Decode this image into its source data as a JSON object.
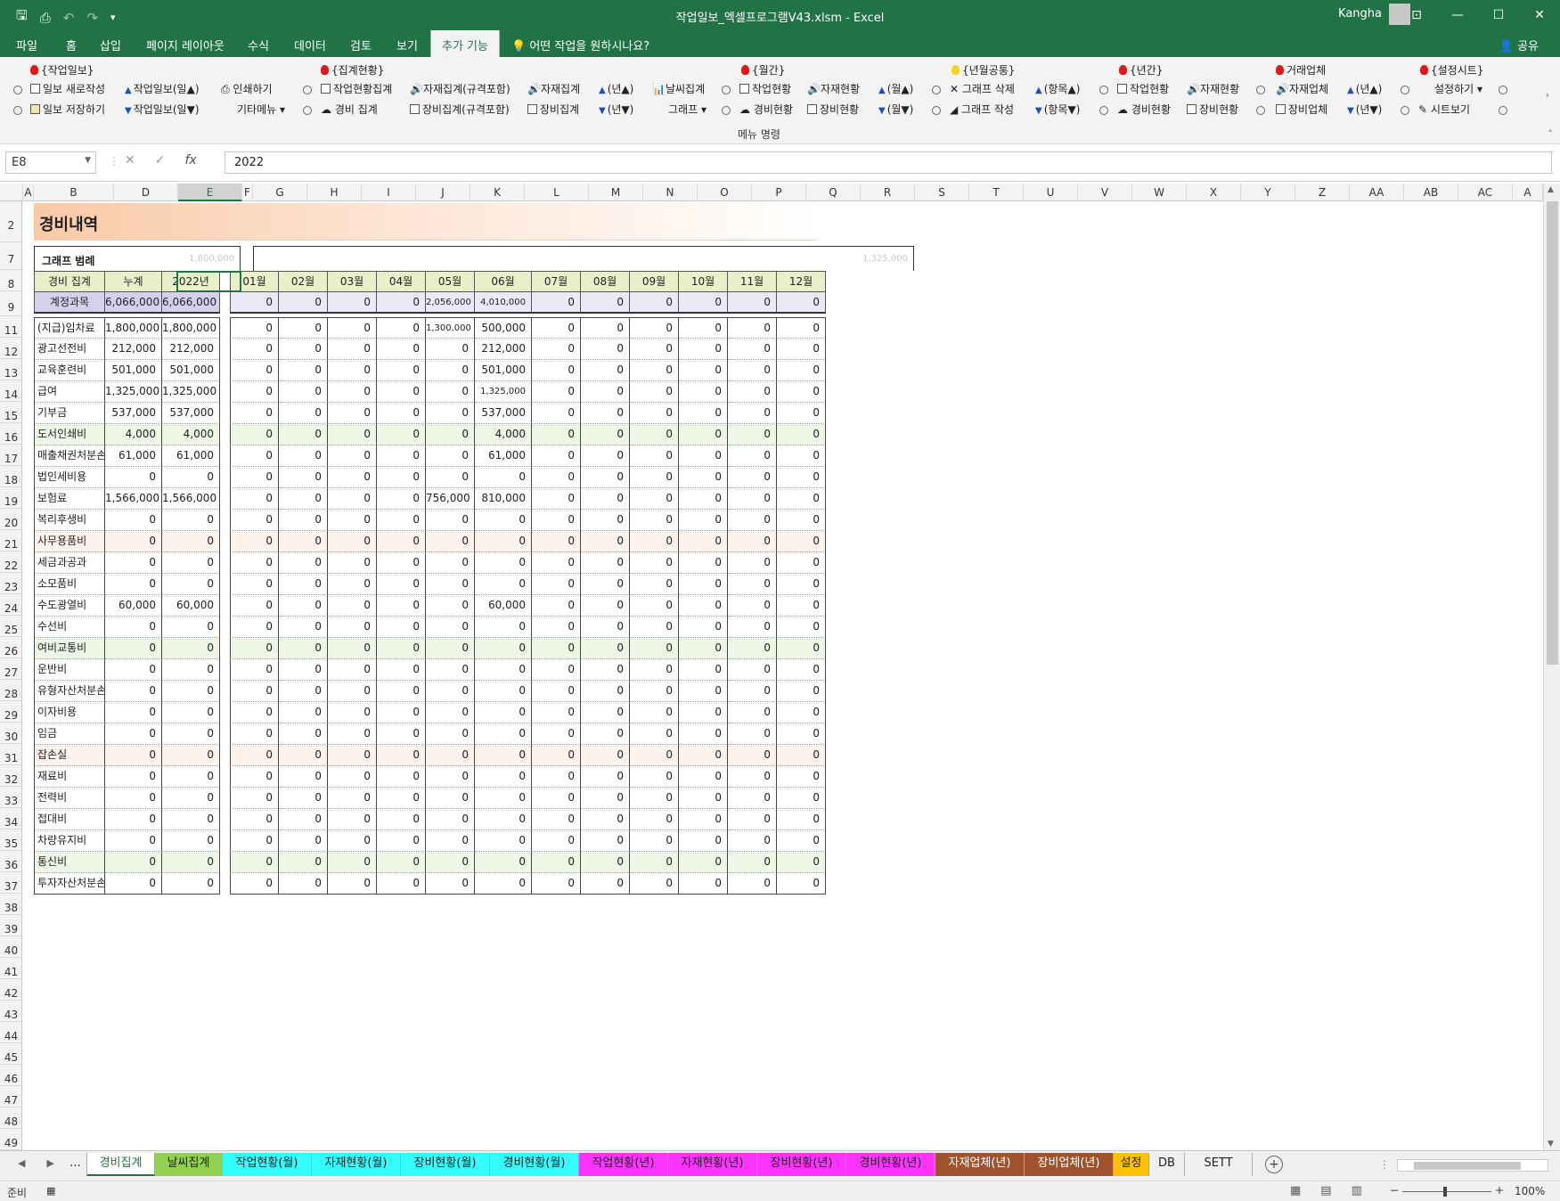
{
  "window": {
    "title": "작업일보_엑셀프로그램V43.xlsm  -  Excel",
    "user": "Kangha"
  },
  "ribbon_tabs": [
    {
      "label": "파일",
      "active": false
    },
    {
      "label": "홈",
      "active": false
    },
    {
      "label": "삽입",
      "active": false
    },
    {
      "label": "페이지 레이아웃",
      "active": false
    },
    {
      "label": "수식",
      "active": false
    },
    {
      "label": "데이터",
      "active": false
    },
    {
      "label": "검토",
      "active": false
    },
    {
      "label": "보기",
      "active": false
    },
    {
      "label": "추가 기능",
      "active": true
    }
  ],
  "tell_me": "어떤 작업을 원하시나요?",
  "share": "공유",
  "ribbon": {
    "groups": [
      {
        "label": "{작업일보}",
        "bulb": "red"
      },
      {
        "label": "{집계현황}",
        "bulb": "red"
      },
      {
        "label": "{월간}",
        "bulb": "red"
      },
      {
        "label": "{년월공통}",
        "bulb": "yellow"
      },
      {
        "label": "{년간}",
        "bulb": "red"
      },
      {
        "label": "거래업체",
        "bulb": "red"
      },
      {
        "label": "{설정시트}",
        "bulb": "red"
      }
    ],
    "row1": [
      "일보 새로작성",
      "작업일보(일▲)",
      "인쇄하기",
      "작업현황집계",
      "자재집계(규격포함)",
      "자재집계",
      "(년▲)",
      "날씨집계",
      "작업현황",
      "자재현황",
      "(월▲)",
      "그래프 삭제",
      "(항목▲)",
      "작업현황",
      "자재현황",
      "자재업체",
      "(년▲)",
      "설정하기"
    ],
    "row2": [
      "일보 저장하기",
      "작업일보(일▼)",
      "기타메뉴",
      "경비 집계",
      "장비집계(규격포함)",
      "장비집계",
      "(년▼)",
      "그래프",
      "경비현황",
      "장비현황",
      "(월▼)",
      "그래프 작성",
      "(항목▼)",
      "경비현황",
      "장비현황",
      "장비업체",
      "(년▼)",
      "시트보기"
    ],
    "menu_label": "메뉴 명령"
  },
  "formula": {
    "namebox": "E8",
    "value": "2022",
    "fx": "fx"
  },
  "columns": [
    {
      "label": "A",
      "selected": false
    },
    {
      "label": "B",
      "selected": false
    },
    {
      "label": "D",
      "selected": false
    },
    {
      "label": "E",
      "selected": true
    },
    {
      "label": "F",
      "selected": false
    },
    {
      "label": "G",
      "selected": false
    },
    {
      "label": "H",
      "selected": false
    },
    {
      "label": "I",
      "selected": false
    },
    {
      "label": "J",
      "selected": false
    },
    {
      "label": "K",
      "selected": false
    },
    {
      "label": "L",
      "selected": false
    },
    {
      "label": "M",
      "selected": false
    },
    {
      "label": "N",
      "selected": false
    },
    {
      "label": "O",
      "selected": false
    },
    {
      "label": "P",
      "selected": false
    },
    {
      "label": "Q",
      "selected": false
    },
    {
      "label": "R",
      "selected": false
    },
    {
      "label": "S",
      "selected": false
    },
    {
      "label": "T",
      "selected": false
    },
    {
      "label": "U",
      "selected": false
    },
    {
      "label": "V",
      "selected": false
    },
    {
      "label": "W",
      "selected": false
    },
    {
      "label": "X",
      "selected": false
    },
    {
      "label": "Y",
      "selected": false
    },
    {
      "label": "Z",
      "selected": false
    },
    {
      "label": "AA",
      "selected": false
    },
    {
      "label": "AB",
      "selected": false
    },
    {
      "label": "AC",
      "selected": false
    },
    {
      "label": "A",
      "selected": false
    }
  ],
  "rows": [
    "2",
    "7",
    "8",
    "9",
    "11",
    "12",
    "13",
    "14",
    "15",
    "16",
    "17",
    "18",
    "19",
    "20",
    "21",
    "22",
    "23",
    "24",
    "25",
    "26",
    "27",
    "28",
    "29",
    "30",
    "31",
    "32",
    "33",
    "34",
    "35",
    "36",
    "37",
    "38",
    "39",
    "40",
    "41",
    "42",
    "43",
    "44",
    "45",
    "46",
    "47",
    "48",
    "49"
  ],
  "sheet": {
    "title": "경비내역",
    "legend_label": "그래프 범례",
    "legend_faint": "1,800,000",
    "right_faint": "1,325,000",
    "headers": [
      "경비 집계",
      "누계",
      "2022년"
    ],
    "months": [
      "01월",
      "02월",
      "03월",
      "04월",
      "05월",
      "06월",
      "07월",
      "08월",
      "09월",
      "10월",
      "11월",
      "12월"
    ],
    "total": {
      "label": "계정과목",
      "cum": "6,066,000",
      "year": "6,066,000",
      "months": [
        "0",
        "0",
        "0",
        "0",
        "2,056,000",
        "4,010,000",
        "0",
        "0",
        "0",
        "0",
        "0",
        "0"
      ]
    },
    "items": [
      {
        "name": "(지급)임차료",
        "cum": "1,800,000",
        "year": "1,800,000",
        "months": [
          "0",
          "0",
          "0",
          "0",
          "1,300,000",
          "500,000",
          "0",
          "0",
          "0",
          "0",
          "0",
          "0"
        ],
        "bg": "#ffffff"
      },
      {
        "name": "광고선전비",
        "cum": "212,000",
        "year": "212,000",
        "months": [
          "0",
          "0",
          "0",
          "0",
          "0",
          "212,000",
          "0",
          "0",
          "0",
          "0",
          "0",
          "0"
        ],
        "bg": "#ffffff"
      },
      {
        "name": "교육훈련비",
        "cum": "501,000",
        "year": "501,000",
        "months": [
          "0",
          "0",
          "0",
          "0",
          "0",
          "501,000",
          "0",
          "0",
          "0",
          "0",
          "0",
          "0"
        ],
        "bg": "#ffffff"
      },
      {
        "name": "급여",
        "cum": "1,325,000",
        "year": "1,325,000",
        "months": [
          "0",
          "0",
          "0",
          "0",
          "0",
          "1,325,000",
          "0",
          "0",
          "0",
          "0",
          "0",
          "0"
        ],
        "bg": "#ffffff"
      },
      {
        "name": "기부금",
        "cum": "537,000",
        "year": "537,000",
        "months": [
          "0",
          "0",
          "0",
          "0",
          "0",
          "537,000",
          "0",
          "0",
          "0",
          "0",
          "0",
          "0"
        ],
        "bg": "#ffffff"
      },
      {
        "name": "도서인쇄비",
        "cum": "4,000",
        "year": "4,000",
        "months": [
          "0",
          "0",
          "0",
          "0",
          "0",
          "4,000",
          "0",
          "0",
          "0",
          "0",
          "0",
          "0"
        ],
        "bg": "#eef7e6"
      },
      {
        "name": "매출채권처분손",
        "cum": "61,000",
        "year": "61,000",
        "months": [
          "0",
          "0",
          "0",
          "0",
          "0",
          "61,000",
          "0",
          "0",
          "0",
          "0",
          "0",
          "0"
        ],
        "bg": "#ffffff"
      },
      {
        "name": "법인세비용",
        "cum": "0",
        "year": "0",
        "months": [
          "0",
          "0",
          "0",
          "0",
          "0",
          "0",
          "0",
          "0",
          "0",
          "0",
          "0",
          "0"
        ],
        "bg": "#ffffff"
      },
      {
        "name": "보험료",
        "cum": "1,566,000",
        "year": "1,566,000",
        "months": [
          "0",
          "0",
          "0",
          "0",
          "756,000",
          "810,000",
          "0",
          "0",
          "0",
          "0",
          "0",
          "0"
        ],
        "bg": "#ffffff"
      },
      {
        "name": "복리후생비",
        "cum": "0",
        "year": "0",
        "months": [
          "0",
          "0",
          "0",
          "0",
          "0",
          "0",
          "0",
          "0",
          "0",
          "0",
          "0",
          "0"
        ],
        "bg": "#ffffff"
      },
      {
        "name": "사무용품비",
        "cum": "0",
        "year": "0",
        "months": [
          "0",
          "0",
          "0",
          "0",
          "0",
          "0",
          "0",
          "0",
          "0",
          "0",
          "0",
          "0"
        ],
        "bg": "#fdf3ea"
      },
      {
        "name": "세금과공과",
        "cum": "0",
        "year": "0",
        "months": [
          "0",
          "0",
          "0",
          "0",
          "0",
          "0",
          "0",
          "0",
          "0",
          "0",
          "0",
          "0"
        ],
        "bg": "#ffffff"
      },
      {
        "name": "소모품비",
        "cum": "0",
        "year": "0",
        "months": [
          "0",
          "0",
          "0",
          "0",
          "0",
          "0",
          "0",
          "0",
          "0",
          "0",
          "0",
          "0"
        ],
        "bg": "#ffffff"
      },
      {
        "name": "수도광열비",
        "cum": "60,000",
        "year": "60,000",
        "months": [
          "0",
          "0",
          "0",
          "0",
          "0",
          "60,000",
          "0",
          "0",
          "0",
          "0",
          "0",
          "0"
        ],
        "bg": "#ffffff"
      },
      {
        "name": "수선비",
        "cum": "0",
        "year": "0",
        "months": [
          "0",
          "0",
          "0",
          "0",
          "0",
          "0",
          "0",
          "0",
          "0",
          "0",
          "0",
          "0"
        ],
        "bg": "#ffffff"
      },
      {
        "name": "여비교통비",
        "cum": "0",
        "year": "0",
        "months": [
          "0",
          "0",
          "0",
          "0",
          "0",
          "0",
          "0",
          "0",
          "0",
          "0",
          "0",
          "0"
        ],
        "bg": "#eef7e6"
      },
      {
        "name": "운반비",
        "cum": "0",
        "year": "0",
        "months": [
          "0",
          "0",
          "0",
          "0",
          "0",
          "0",
          "0",
          "0",
          "0",
          "0",
          "0",
          "0"
        ],
        "bg": "#ffffff"
      },
      {
        "name": "유형자산처분손",
        "cum": "0",
        "year": "0",
        "months": [
          "0",
          "0",
          "0",
          "0",
          "0",
          "0",
          "0",
          "0",
          "0",
          "0",
          "0",
          "0"
        ],
        "bg": "#ffffff"
      },
      {
        "name": "이자비용",
        "cum": "0",
        "year": "0",
        "months": [
          "0",
          "0",
          "0",
          "0",
          "0",
          "0",
          "0",
          "0",
          "0",
          "0",
          "0",
          "0"
        ],
        "bg": "#ffffff"
      },
      {
        "name": "임금",
        "cum": "0",
        "year": "0",
        "months": [
          "0",
          "0",
          "0",
          "0",
          "0",
          "0",
          "0",
          "0",
          "0",
          "0",
          "0",
          "0"
        ],
        "bg": "#ffffff"
      },
      {
        "name": "잡손실",
        "cum": "0",
        "year": "0",
        "months": [
          "0",
          "0",
          "0",
          "0",
          "0",
          "0",
          "0",
          "0",
          "0",
          "0",
          "0",
          "0"
        ],
        "bg": "#fdf3ea"
      },
      {
        "name": "재료비",
        "cum": "0",
        "year": "0",
        "months": [
          "0",
          "0",
          "0",
          "0",
          "0",
          "0",
          "0",
          "0",
          "0",
          "0",
          "0",
          "0"
        ],
        "bg": "#ffffff"
      },
      {
        "name": "전력비",
        "cum": "0",
        "year": "0",
        "months": [
          "0",
          "0",
          "0",
          "0",
          "0",
          "0",
          "0",
          "0",
          "0",
          "0",
          "0",
          "0"
        ],
        "bg": "#ffffff"
      },
      {
        "name": "접대비",
        "cum": "0",
        "year": "0",
        "months": [
          "0",
          "0",
          "0",
          "0",
          "0",
          "0",
          "0",
          "0",
          "0",
          "0",
          "0",
          "0"
        ],
        "bg": "#ffffff"
      },
      {
        "name": "차량유지비",
        "cum": "0",
        "year": "0",
        "months": [
          "0",
          "0",
          "0",
          "0",
          "0",
          "0",
          "0",
          "0",
          "0",
          "0",
          "0",
          "0"
        ],
        "bg": "#ffffff"
      },
      {
        "name": "통신비",
        "cum": "0",
        "year": "0",
        "months": [
          "0",
          "0",
          "0",
          "0",
          "0",
          "0",
          "0",
          "0",
          "0",
          "0",
          "0",
          "0"
        ],
        "bg": "#eef7e6"
      },
      {
        "name": "투자자산처분손",
        "cum": "0",
        "year": "0",
        "months": [
          "0",
          "0",
          "0",
          "0",
          "0",
          "0",
          "0",
          "0",
          "0",
          "0",
          "0",
          "0"
        ],
        "bg": "#ffffff"
      }
    ]
  },
  "sheet_tabs": [
    {
      "label": "...",
      "color": "#f0f0f0",
      "active": false
    },
    {
      "label": "경비집계",
      "color": "#ffffff",
      "active": true
    },
    {
      "label": "날씨집계",
      "color": "#92d050",
      "active": false
    },
    {
      "label": "작업현황(월)",
      "color": "#33ffff",
      "active": false
    },
    {
      "label": "자재현황(월)",
      "color": "#33ffff",
      "active": false
    },
    {
      "label": "장비현황(월)",
      "color": "#33ffff",
      "active": false
    },
    {
      "label": "경비현황(월)",
      "color": "#33ffff",
      "active": false
    },
    {
      "label": "작업현황(년)",
      "color": "#ff33ff",
      "active": false
    },
    {
      "label": "자재현황(년)",
      "color": "#ff33ff",
      "active": false
    },
    {
      "label": "장비현황(년)",
      "color": "#ff33ff",
      "active": false
    },
    {
      "label": "경비현황(년)",
      "color": "#ff33ff",
      "active": false
    },
    {
      "label": "자재업체(년)",
      "color": "#a0522d",
      "active": false
    },
    {
      "label": "장비업체(년)",
      "color": "#a0522d",
      "active": false
    },
    {
      "label": "설정",
      "color": "#ffc000",
      "active": false
    },
    {
      "label": "DB",
      "color": "#f0f0f0",
      "active": false
    },
    {
      "label": "SETT",
      "color": "#f0f0f0",
      "active": false
    }
  ],
  "status": {
    "ready": "준비",
    "zoom": "100%"
  }
}
